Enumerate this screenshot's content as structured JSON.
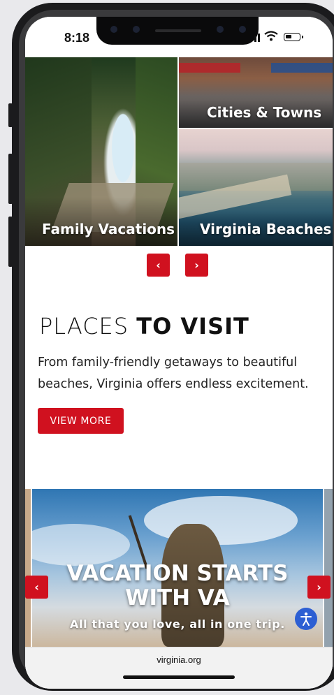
{
  "status_bar": {
    "time": "8:18"
  },
  "tiles": [
    {
      "label": "Family Vacations"
    },
    {
      "label": "Cities & Towns"
    },
    {
      "label": "Virginia Beaches"
    }
  ],
  "carousel": {
    "prev_icon": "‹",
    "next_icon": "›"
  },
  "section": {
    "title_light": "PLACES",
    "title_bold": "TO VISIT",
    "description": "From family-friendly getaways to beautiful beaches, Virginia offers endless excitement.",
    "button": "VIEW MORE"
  },
  "hero": {
    "title_line1": "VACATION STARTS",
    "title_line2": "WITH VA",
    "subtitle": "All that you love, all in one trip.",
    "prev_icon": "‹",
    "next_icon": "›"
  },
  "browser": {
    "url": "virginia.org"
  },
  "colors": {
    "accent": "#d0111f",
    "a11y": "#2d5fd3"
  }
}
